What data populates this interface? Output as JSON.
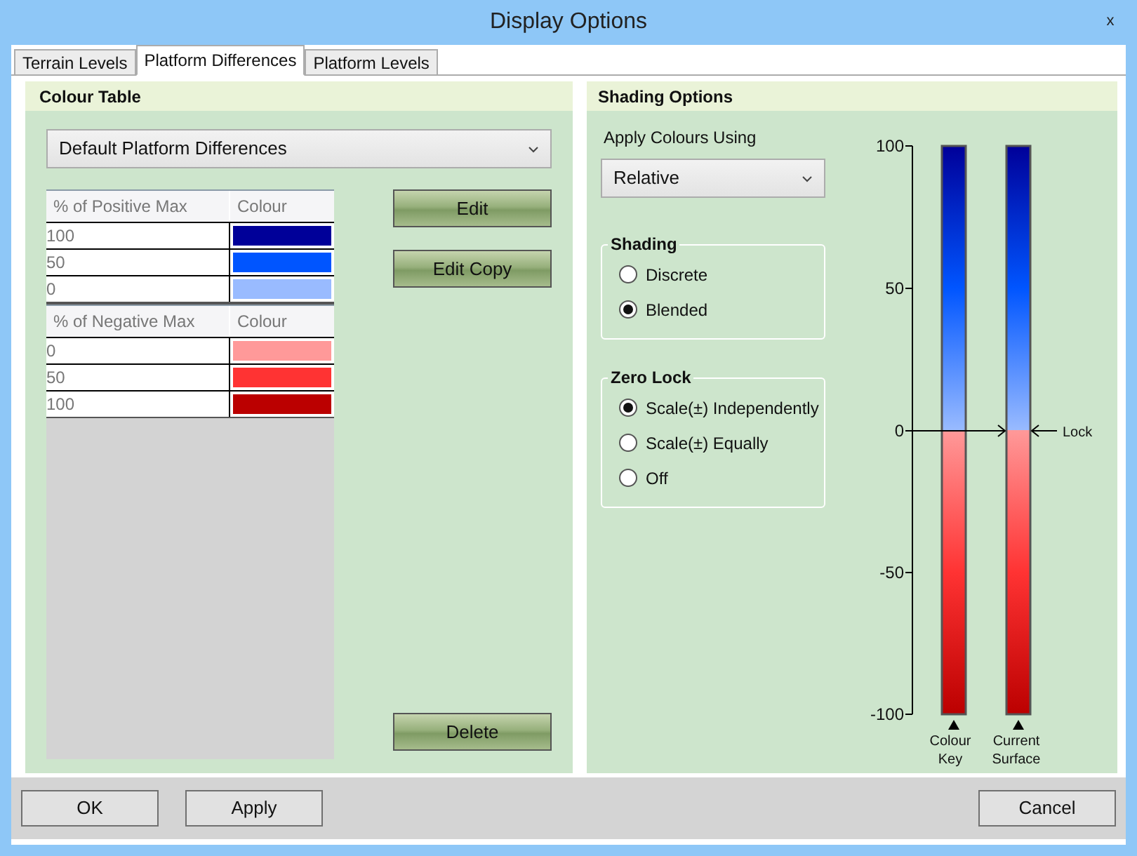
{
  "window": {
    "title": "Display Options",
    "close": "x"
  },
  "tabs": [
    {
      "label": "Terrain Levels",
      "selected": false
    },
    {
      "label": "Platform Differences",
      "selected": true
    },
    {
      "label": "Platform Levels",
      "selected": false
    }
  ],
  "colour_table": {
    "title": "Colour Table",
    "preset": "Default Platform Differences",
    "positive": {
      "columns": [
        "% of Positive Max",
        "Colour"
      ],
      "rows": [
        {
          "value": "100",
          "color": "#000099"
        },
        {
          "value": "50",
          "color": "#0055ff"
        },
        {
          "value": "0",
          "color": "#99bbff"
        }
      ]
    },
    "negative": {
      "columns": [
        "% of Negative Max",
        "Colour"
      ],
      "rows": [
        {
          "value": "0",
          "color": "#ff9999"
        },
        {
          "value": "50",
          "color": "#ff3333"
        },
        {
          "value": "100",
          "color": "#bb0000"
        }
      ]
    },
    "buttons": [
      "Edit",
      "Edit Copy",
      "Delete"
    ]
  },
  "shading_options": {
    "title": "Shading Options",
    "apply_label": "Apply Colours Using",
    "apply_value": "Relative",
    "shading": {
      "title": "Shading",
      "options": [
        {
          "label": "Discrete",
          "selected": false
        },
        {
          "label": "Blended",
          "selected": true
        }
      ]
    },
    "zero_lock": {
      "title": "Zero Lock",
      "options": [
        {
          "label": "Scale(±) Independently",
          "selected": true
        },
        {
          "label": "Scale(±) Equally",
          "selected": false
        },
        {
          "label": "Off",
          "selected": false
        }
      ]
    },
    "scale": {
      "ticks": [
        "100",
        "50",
        "0",
        "-50",
        "-100"
      ],
      "lock_label": "Lock",
      "bars": [
        "Colour Key",
        "Current Surface"
      ]
    }
  },
  "footer": {
    "left": [
      "OK",
      "Apply"
    ],
    "right": [
      "Cancel"
    ]
  }
}
